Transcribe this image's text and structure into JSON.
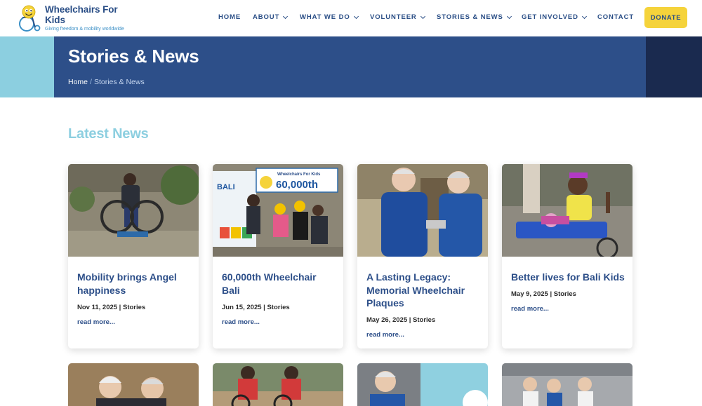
{
  "header": {
    "logo_title": "Wheelchairs For Kids",
    "logo_tagline": "Giving freedom & mobility worldwide",
    "nav": [
      {
        "label": "HOME",
        "dropdown": false
      },
      {
        "label": "ABOUT",
        "dropdown": true
      },
      {
        "label": "WHAT WE DO",
        "dropdown": true
      },
      {
        "label": "VOLUNTEER",
        "dropdown": true
      },
      {
        "label": "STORIES & NEWS",
        "dropdown": true
      },
      {
        "label": "GET INVOLVED",
        "dropdown": true
      },
      {
        "label": "CONTACT",
        "dropdown": false
      }
    ],
    "donate_label": "DONATE"
  },
  "hero": {
    "title": "Stories & News",
    "breadcrumb_home": "Home",
    "breadcrumb_sep": "/",
    "breadcrumb_current": "Stories & News"
  },
  "section_title": "Latest News",
  "cards": [
    {
      "title": "Mobility brings Angel happiness",
      "meta": "Nov 11, 2025 | Stories",
      "more": "read more..."
    },
    {
      "title": "60,000th Wheelchair Bali",
      "meta": "Jun 15, 2025 | Stories",
      "more": "read more..."
    },
    {
      "title": "A Lasting Legacy: Memorial Wheelchair Plaques",
      "meta": "May 26, 2025 | Stories",
      "more": "read more..."
    },
    {
      "title": "Better lives for Bali Kids",
      "meta": "May 9, 2025 | Stories",
      "more": "read more..."
    }
  ],
  "photo_texts": {
    "banner_big": "60,000th",
    "banner_small": "Wheelchairs For Kids",
    "bali_sign": "BALI"
  },
  "colors": {
    "brand_blue": "#2d4f89",
    "light_blue": "#8dcfe0",
    "navy": "#1a2a4f",
    "donate_yellow": "#f5d33b"
  }
}
